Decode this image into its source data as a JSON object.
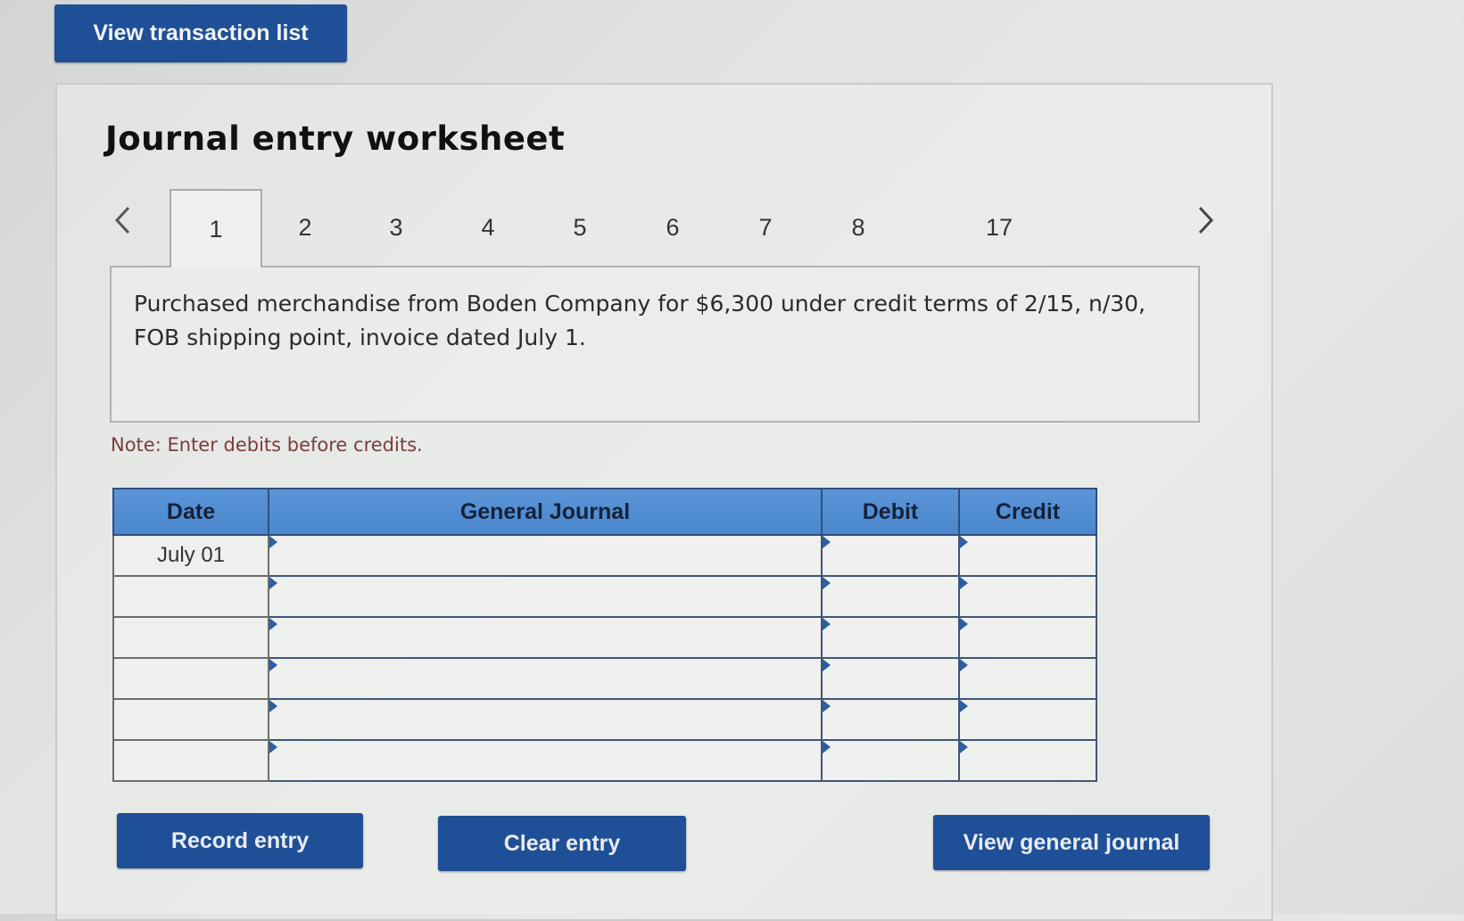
{
  "top_button": {
    "label": "View transaction list"
  },
  "worksheet": {
    "title": "Journal entry worksheet",
    "tabs": [
      {
        "label": "1",
        "active": true
      },
      {
        "label": "2",
        "active": false
      },
      {
        "label": "3",
        "active": false
      },
      {
        "label": "4",
        "active": false
      },
      {
        "label": "5",
        "active": false
      },
      {
        "label": "6",
        "active": false
      },
      {
        "label": "7",
        "active": false
      },
      {
        "label": "8",
        "active": false
      },
      {
        "label": "17",
        "active": false
      }
    ],
    "prev_icon": "chevron-left-icon",
    "next_icon": "chevron-right-icon",
    "description": "Purchased merchandise from Boden Company for $6,300 under credit terms of 2/15, n/30, FOB shipping point, invoice dated July 1.",
    "note": "Note: Enter debits before credits."
  },
  "journal_table": {
    "headers": {
      "date": "Date",
      "general_journal": "General Journal",
      "debit": "Debit",
      "credit": "Credit"
    },
    "rows": [
      {
        "date": "July 01",
        "account": "",
        "debit": "",
        "credit": ""
      },
      {
        "date": "",
        "account": "",
        "debit": "",
        "credit": ""
      },
      {
        "date": "",
        "account": "",
        "debit": "",
        "credit": ""
      },
      {
        "date": "",
        "account": "",
        "debit": "",
        "credit": ""
      },
      {
        "date": "",
        "account": "",
        "debit": "",
        "credit": ""
      },
      {
        "date": "",
        "account": "",
        "debit": "",
        "credit": ""
      }
    ]
  },
  "actions": {
    "record_entry": "Record entry",
    "clear_entry": "Clear entry",
    "view_general_journal": "View general journal"
  },
  "colors": {
    "button_blue": "#1f4f96",
    "header_blue": "#4a86cc",
    "note_text": "#7a3d3a"
  }
}
